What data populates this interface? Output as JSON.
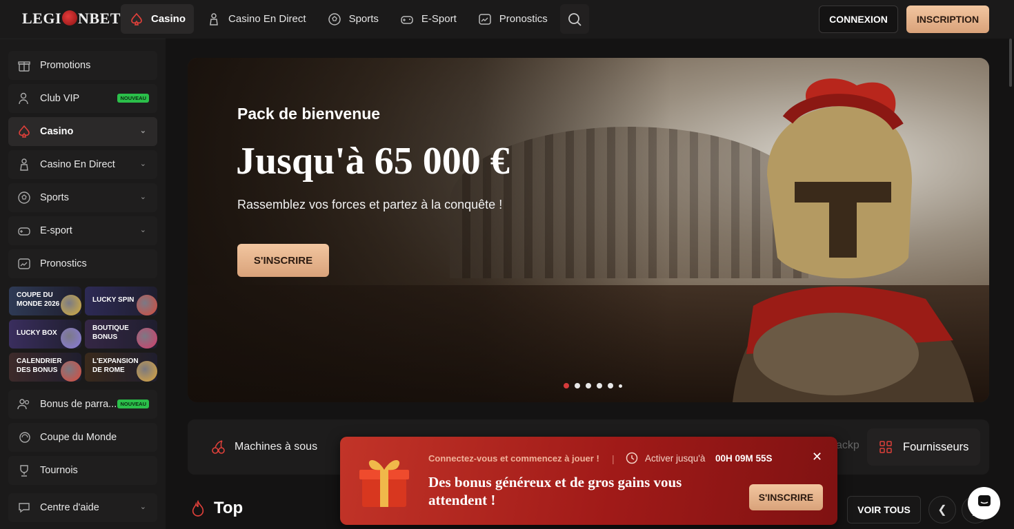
{
  "header": {
    "logo_text": "LEGIONBET",
    "nav": [
      {
        "label": "Casino",
        "icon": "spade-icon",
        "active": true
      },
      {
        "label": "Casino En Direct",
        "icon": "dealer-icon"
      },
      {
        "label": "Sports",
        "icon": "soccer-ball-icon"
      },
      {
        "label": "E-Sport",
        "icon": "gamepad-icon"
      },
      {
        "label": "Pronostics",
        "icon": "chart-icon"
      }
    ],
    "login_label": "CONNEXION",
    "signup_label": "INSCRIPTION"
  },
  "sidebar": {
    "items": [
      {
        "label": "Promotions",
        "icon": "gift-icon"
      },
      {
        "label": "Club VIP",
        "icon": "user-icon",
        "badge": "NOUVEAU"
      },
      {
        "label": "Casino",
        "icon": "spade-icon",
        "active": true,
        "expandable": true
      },
      {
        "label": "Casino En Direct",
        "icon": "dealer-icon",
        "expandable": true
      },
      {
        "label": "Sports",
        "icon": "soccer-ball-icon",
        "expandable": true
      },
      {
        "label": "E-sport",
        "icon": "gamepad-icon",
        "expandable": true
      },
      {
        "label": "Pronostics",
        "icon": "chart-icon"
      }
    ],
    "tiles": [
      {
        "line1": "COUPE DU",
        "line2": "MONDE 2026",
        "bg": "#2e3a55",
        "art": "#d9b13b"
      },
      {
        "line1": "LUCKY SPIN",
        "line2": "",
        "bg": "#2d2a55",
        "art": "#d94a3b"
      },
      {
        "line1": "LUCKY BOX",
        "line2": "",
        "bg": "#3a2e5e",
        "art": "#8b7be0"
      },
      {
        "line1": "BOUTIQUE",
        "line2": "BONUS",
        "bg": "#352745",
        "art": "#d83b6a"
      },
      {
        "line1": "CALENDRIER",
        "line2": "DES BONUS",
        "bg": "#3d2a2a",
        "art": "#e04a3b"
      },
      {
        "line1": "L'EXPANSION",
        "line2": "DE ROME",
        "bg": "#3a2a1c",
        "art": "#e0a83b"
      }
    ],
    "items2": [
      {
        "label": "Bonus de parra...",
        "icon": "people-icon",
        "badge": "NOUVEAU"
      },
      {
        "label": "Coupe du Monde",
        "icon": "trophy-ball-icon"
      },
      {
        "label": "Tournois",
        "icon": "trophy-icon"
      },
      {
        "label": "Centre d'aide",
        "icon": "help-chat-icon",
        "expandable": true
      }
    ]
  },
  "hero": {
    "subtitle": "Pack de bienvenue",
    "title": "Jusqu'à 65 000 €",
    "description": "Rassemblez vos forces et partez à la conquête !",
    "cta": "S'INSCRIRE",
    "slides": 6,
    "active_slide": 1
  },
  "categories": {
    "items": [
      {
        "label": "Machines à sous",
        "icon": "cherry-icon"
      }
    ],
    "partial_label": "ackp",
    "providers_label": "Fournisseurs"
  },
  "section": {
    "title": "Top",
    "see_all": "VOIR TOUS"
  },
  "promo": {
    "small_text": "Connectez-vous et commencez à jouer !",
    "timer_label": "Activer jusqu'à",
    "timer_value": "00H 09M 55S",
    "title": "Des bonus généreux et de gros gains vous attendent !",
    "cta": "S'INSCRIRE"
  },
  "colors": {
    "accent": "#d63b3b",
    "gold": "#e6b48a",
    "badge": "#2bbf4a"
  }
}
